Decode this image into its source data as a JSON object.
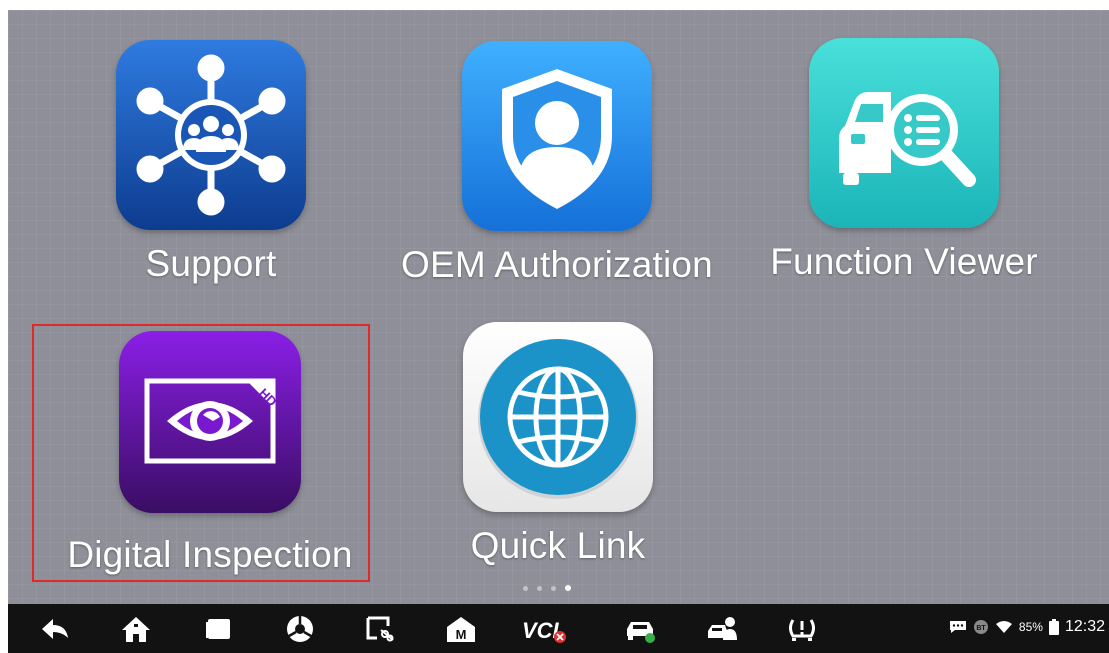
{
  "apps": [
    {
      "id": "support",
      "label": "Support",
      "icon": "support-network-icon",
      "color_top": "#2f7be0",
      "color_bottom": "#0d3c8f"
    },
    {
      "id": "oem",
      "label": "OEM Authorization",
      "icon": "oem-shield-user-icon",
      "color_top": "#3fb0ff",
      "color_bottom": "#1570d8"
    },
    {
      "id": "function",
      "label": "Function Viewer",
      "icon": "function-viewer-car-search-icon",
      "color_top": "#49e0da",
      "color_bottom": "#1bb4b8"
    },
    {
      "id": "digital",
      "label": "Digital Inspection",
      "icon": "digital-inspection-eye-icon",
      "badge": "HD",
      "color_top": "#8a1fe6",
      "color_bottom": "#3a0d63"
    },
    {
      "id": "quicklink",
      "label": "Quick Link",
      "icon": "globe-icon",
      "color_top": "#ffffff",
      "color_bottom": "#e6e6e6"
    }
  ],
  "highlighted_app": "Digital Inspection",
  "highlight_color": "#e02a2a",
  "pager": {
    "count": 4,
    "active_index": 3
  },
  "navbar": {
    "buttons": [
      "back-icon",
      "home-icon",
      "recent-apps-icon",
      "browser-icon",
      "screenshot-icon",
      "maxifix-icon",
      "vci-icon",
      "vehicle-icon",
      "shop-manager-icon",
      "tpms-warning-icon"
    ],
    "vci_label": "VCI",
    "maxifix_label": "M"
  },
  "status": {
    "battery_percent": "85%",
    "time": "12:32",
    "bt_label": "BT"
  }
}
